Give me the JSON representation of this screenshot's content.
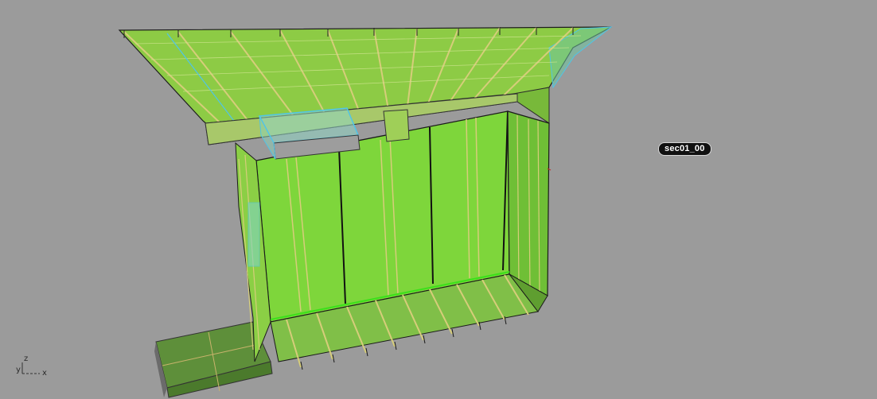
{
  "viewport": {
    "object_tag": "sec01_00",
    "axes": {
      "z": "z",
      "y": "y",
      "x": "x"
    }
  },
  "colors": {
    "background": "#9b9b9b",
    "panel_fill": "#7dd63a",
    "roof_fill": "#8fd040",
    "edge": "#1a1a1a",
    "frame_edge": "#d8c57a",
    "blue_edge": "#4fc4e8",
    "selection_box": "#9a9a9a"
  }
}
